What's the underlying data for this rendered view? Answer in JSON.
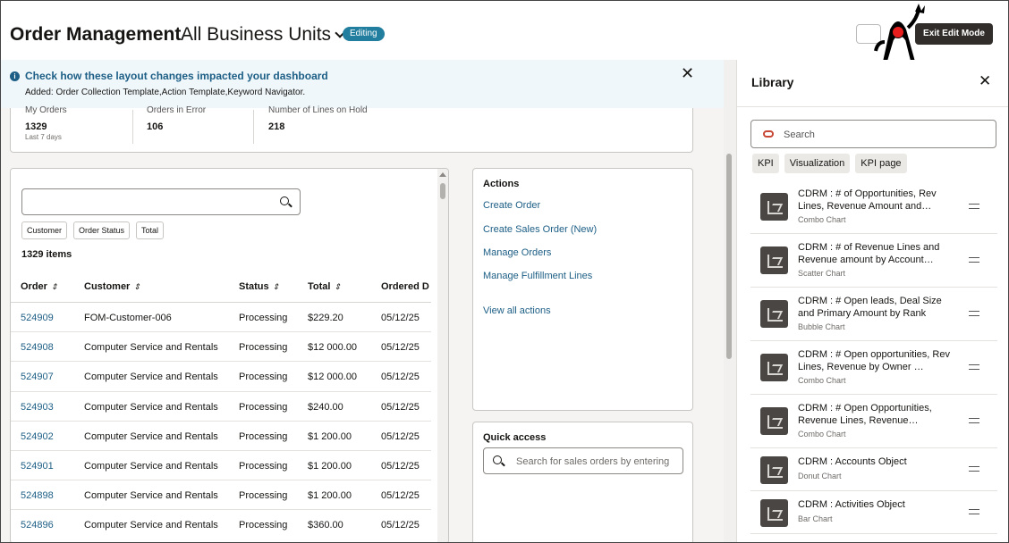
{
  "header": {
    "app_title": "Order Management",
    "business_unit": "All Business Units",
    "mode_badge": "Editing",
    "exit_button": "Exit Edit Mode"
  },
  "banner": {
    "title": "Check how these layout changes impacted your dashboard",
    "message": "Added: Order Collection Template,Action Template,Keyword Navigator.",
    "close": "✕"
  },
  "kpis": [
    {
      "label": "My Orders",
      "value": "1329",
      "sub": "Last 7 days"
    },
    {
      "label": "Orders in Error",
      "value": "106",
      "sub": ""
    },
    {
      "label": "Number of Lines on Hold",
      "value": "218",
      "sub": ""
    }
  ],
  "orders": {
    "filter_chips": [
      "Customer",
      "Order Status",
      "Total"
    ],
    "item_count": "1329 items",
    "columns": [
      "Order",
      "Customer",
      "Status",
      "Total",
      "Ordered D"
    ],
    "sort_icon": "⇕",
    "rows": [
      {
        "order": "524909",
        "customer": "FOM-Customer-006",
        "status": "Processing",
        "total": "$229.20",
        "date": "05/12/25"
      },
      {
        "order": "524908",
        "customer": "Computer Service and Rentals",
        "status": "Processing",
        "total": "$12 000.00",
        "date": "05/12/25"
      },
      {
        "order": "524907",
        "customer": "Computer Service and Rentals",
        "status": "Processing",
        "total": "$12 000.00",
        "date": "05/12/25"
      },
      {
        "order": "524903",
        "customer": "Computer Service and Rentals",
        "status": "Processing",
        "total": "$240.00",
        "date": "05/12/25"
      },
      {
        "order": "524902",
        "customer": "Computer Service and Rentals",
        "status": "Processing",
        "total": "$1 200.00",
        "date": "05/12/25"
      },
      {
        "order": "524901",
        "customer": "Computer Service and Rentals",
        "status": "Processing",
        "total": "$1 200.00",
        "date": "05/12/25"
      },
      {
        "order": "524898",
        "customer": "Computer Service and Rentals",
        "status": "Processing",
        "total": "$1 200.00",
        "date": "05/12/25"
      },
      {
        "order": "524896",
        "customer": "Computer Service and Rentals",
        "status": "Processing",
        "total": "$360.00",
        "date": "05/12/25"
      }
    ]
  },
  "actions": {
    "title": "Actions",
    "links": [
      "Create Order",
      "Create Sales Order (New)",
      "Manage Orders",
      "Manage Fulfillment Lines"
    ],
    "view_all": "View all actions"
  },
  "quick_access": {
    "title": "Quick access",
    "placeholder": "Search for sales orders by entering"
  },
  "library": {
    "title": "Library",
    "close": "✕",
    "search_placeholder": "Search",
    "chips": [
      "KPI",
      "Visualization",
      "KPI page"
    ],
    "items": [
      {
        "name": "CDRM : # of Opportunities, Rev Lines, Revenue Amount and…",
        "type": "Combo Chart"
      },
      {
        "name": "CDRM : # of Revenue Lines and Revenue amount by Account…",
        "type": "Scatter Chart"
      },
      {
        "name": "CDRM : # Open leads, Deal Size and Primary Amount by Rank",
        "type": "Bubble Chart"
      },
      {
        "name": "CDRM : # Open opportunities, Rev Lines, Revenue by Owner …",
        "type": "Combo Chart"
      },
      {
        "name": "CDRM : # Open Opportunities, Revenue Lines, Revenue…",
        "type": "Combo Chart"
      },
      {
        "name": "CDRM : Accounts Object",
        "type": "Donut Chart"
      },
      {
        "name": "CDRM : Activities Object",
        "type": "Bar Chart"
      }
    ]
  },
  "colors": {
    "accent": "#227e9e",
    "link": "#1c5e85",
    "dark_button": "#312d2a",
    "oracle_red": "#c74634"
  }
}
